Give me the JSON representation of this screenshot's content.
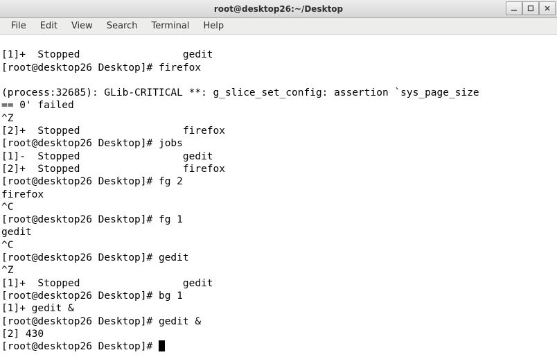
{
  "window": {
    "title": "root@desktop26:~/Desktop"
  },
  "menubar": {
    "items": [
      "File",
      "Edit",
      "View",
      "Search",
      "Terminal",
      "Help"
    ]
  },
  "terminal": {
    "lines": [
      "[1]+  Stopped                 gedit",
      "[root@desktop26 Desktop]# firefox",
      "",
      "(process:32685): GLib-CRITICAL **: g_slice_set_config: assertion `sys_page_size ",
      "== 0' failed",
      "^Z",
      "[2]+  Stopped                 firefox",
      "[root@desktop26 Desktop]# jobs",
      "[1]-  Stopped                 gedit",
      "[2]+  Stopped                 firefox",
      "[root@desktop26 Desktop]# fg 2",
      "firefox",
      "^C",
      "[root@desktop26 Desktop]# fg 1",
      "gedit",
      "^C",
      "[root@desktop26 Desktop]# gedit",
      "^Z",
      "[1]+  Stopped                 gedit",
      "[root@desktop26 Desktop]# bg 1",
      "[1]+ gedit &",
      "[root@desktop26 Desktop]# gedit &",
      "[2] 430"
    ],
    "prompt": "[root@desktop26 Desktop]# "
  }
}
